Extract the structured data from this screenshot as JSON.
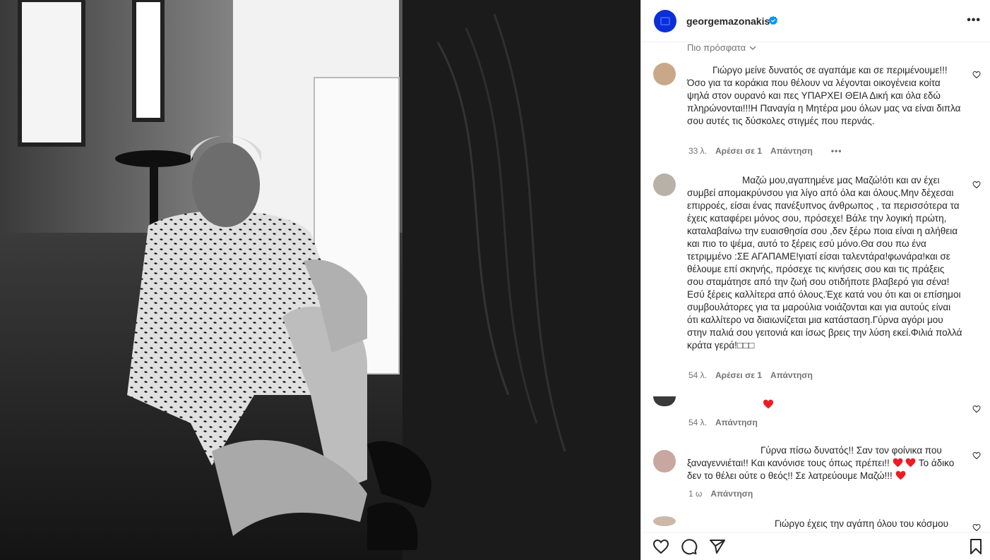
{
  "post": {
    "username": "georgemazonakis",
    "verified": true,
    "more_label": "•••",
    "sort_label": "Πιο πρόσφατα"
  },
  "comments": [
    {
      "text": "Γιώργο μείνε δυνατός σε αγαπάμε και σε περιμένουμε!!!Όσο για τα κοράκια που θέλουν να λέγονται οικογένεια κοίτα ψηλά στον ουρανό και πες ΥΠΑΡΧΕΙ ΘΕΙΑ Δική και όλα εδώ πληρώνονται!!!Η Παναγία η Μητέρα μου όλων μας να είναι διπλα σου αυτές τις δύσκολες στιγμές που περνάς.",
      "time": "33 λ.",
      "likes": "Αρέσει σε 1",
      "reply": "Απάντηση",
      "options": "•••"
    },
    {
      "text": "Μαζώ μου,αγαπημένε μας Μαζώ!ότι και αν έχει συμβεί απομακρύνσου για λίγο από όλα και όλους.Μην δέχεσαι επιρροές, είσαι ένας πανέξυπνος άνθρωπος , τα περισσότερα τα έχεις καταφέρει μόνος σου, πρόσεχε! Βάλε την λογική πρώτη, καταλαβαίνω την ευαισθησία σου ,δεν ξέρω ποια είναι η αλήθεια και πιο το ψέμα, αυτό το ξέρεις εσύ μόνο.Θα σου πω ένα τετριμμένο :ΣΕ ΑΓΑΠΑΜΕ!γιατί είσαι ταλεντάρα!φωνάρα!και σε θέλουμε επί σκηνής, πρόσεχε τις κινήσεις σου και τις πράξεις σου σταμάτησε από την ζωή σου οτιδήποτε βλαβερό για σένα! Εσύ ξέρεις καλλίτερα από όλους.Έχε κατά νου ότι και οι επίσημοι συμβουλάτορες για τα μαρούλια νοιάζονται και για αυτούς είναι ότι καλλίτερο να διαιωνίζεται μια κατάσταση.Γύρνα αγόρι μου στην παλιά σου γειτονιά και ίσως βρεις την λύση εκεί.Φιλιά πολλά κράτα γερά!□□□",
      "time": "54 λ.",
      "likes": "Αρέσει σε 1",
      "reply": "Απάντηση"
    },
    {
      "text": "",
      "time": "54 λ.",
      "reply": "Απάντηση"
    },
    {
      "text_a": "Γύρνα πίσω δυνατός!! Σαν τον φοίνικα που ξαναγεννιέται!! Και κανόνισε τους όπως πρέπει!!",
      "text_b": "Το άδικο δεν το θέλει ούτε ο θεός!! Σε λατρεύουμε Μαζώ!!!",
      "time": "1 ω",
      "reply": "Απάντηση"
    },
    {
      "text": "Γιώργο έχεις την αγάπη όλου του κόσμου"
    }
  ],
  "icons": {
    "like": "heart-icon",
    "comment": "comment-icon",
    "share": "share-icon",
    "save": "bookmark-icon"
  },
  "colors": {
    "verified": "#0095f6",
    "heart_red": "#ed1c24",
    "avatar_blue": "#0b2fd6"
  }
}
